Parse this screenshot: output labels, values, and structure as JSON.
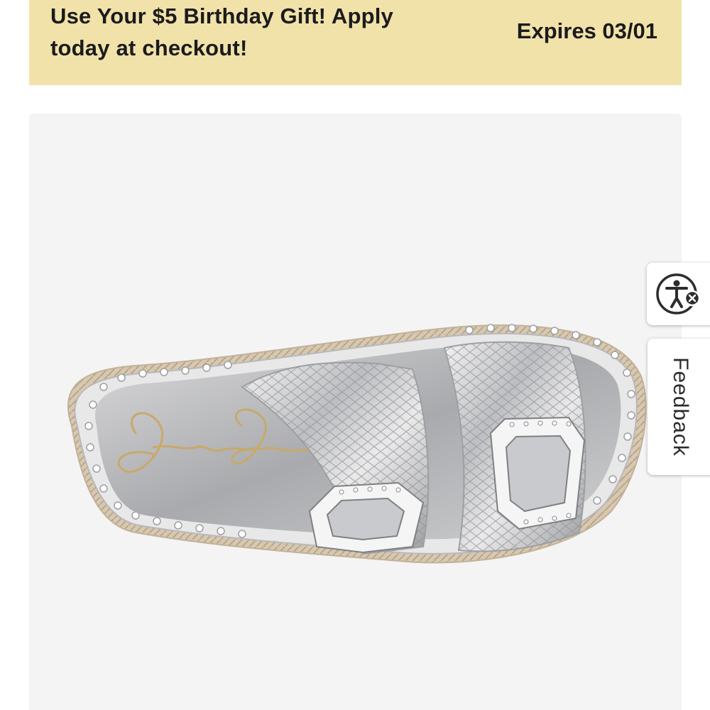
{
  "promo": {
    "message": "Use Your $5 Birthday Gift! Apply today at checkout!",
    "expiry": "Expires 03/01",
    "background_color": "#f1e2aa"
  },
  "product": {
    "image_subject": "silver metallic snake-embossed double-buckle slide sandal with rhinestone buckles",
    "image_background_color": "#f4f4f4"
  },
  "widgets": {
    "accessibility_icon": "accessibility-person-icon",
    "feedback_label": "Feedback"
  }
}
